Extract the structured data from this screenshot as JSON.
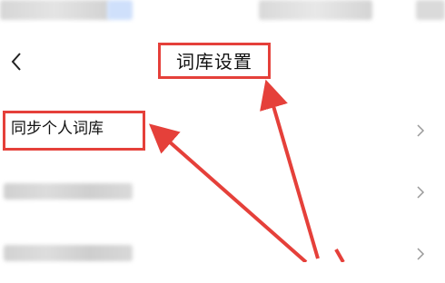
{
  "header": {
    "title": "词库设置",
    "back_icon": "chevron-left-icon"
  },
  "settings": {
    "rows": [
      {
        "label": "同步个人词库",
        "icon": "chevron-right-icon"
      },
      {
        "label": "",
        "icon": "chevron-right-icon"
      },
      {
        "label": "",
        "icon": "chevron-right-icon"
      }
    ]
  },
  "colors": {
    "annotation": "#e5403a",
    "chevron": "#9a9a9a",
    "blur_gray": "#d9d9d9",
    "blur_blue": "#cfe0fb"
  }
}
